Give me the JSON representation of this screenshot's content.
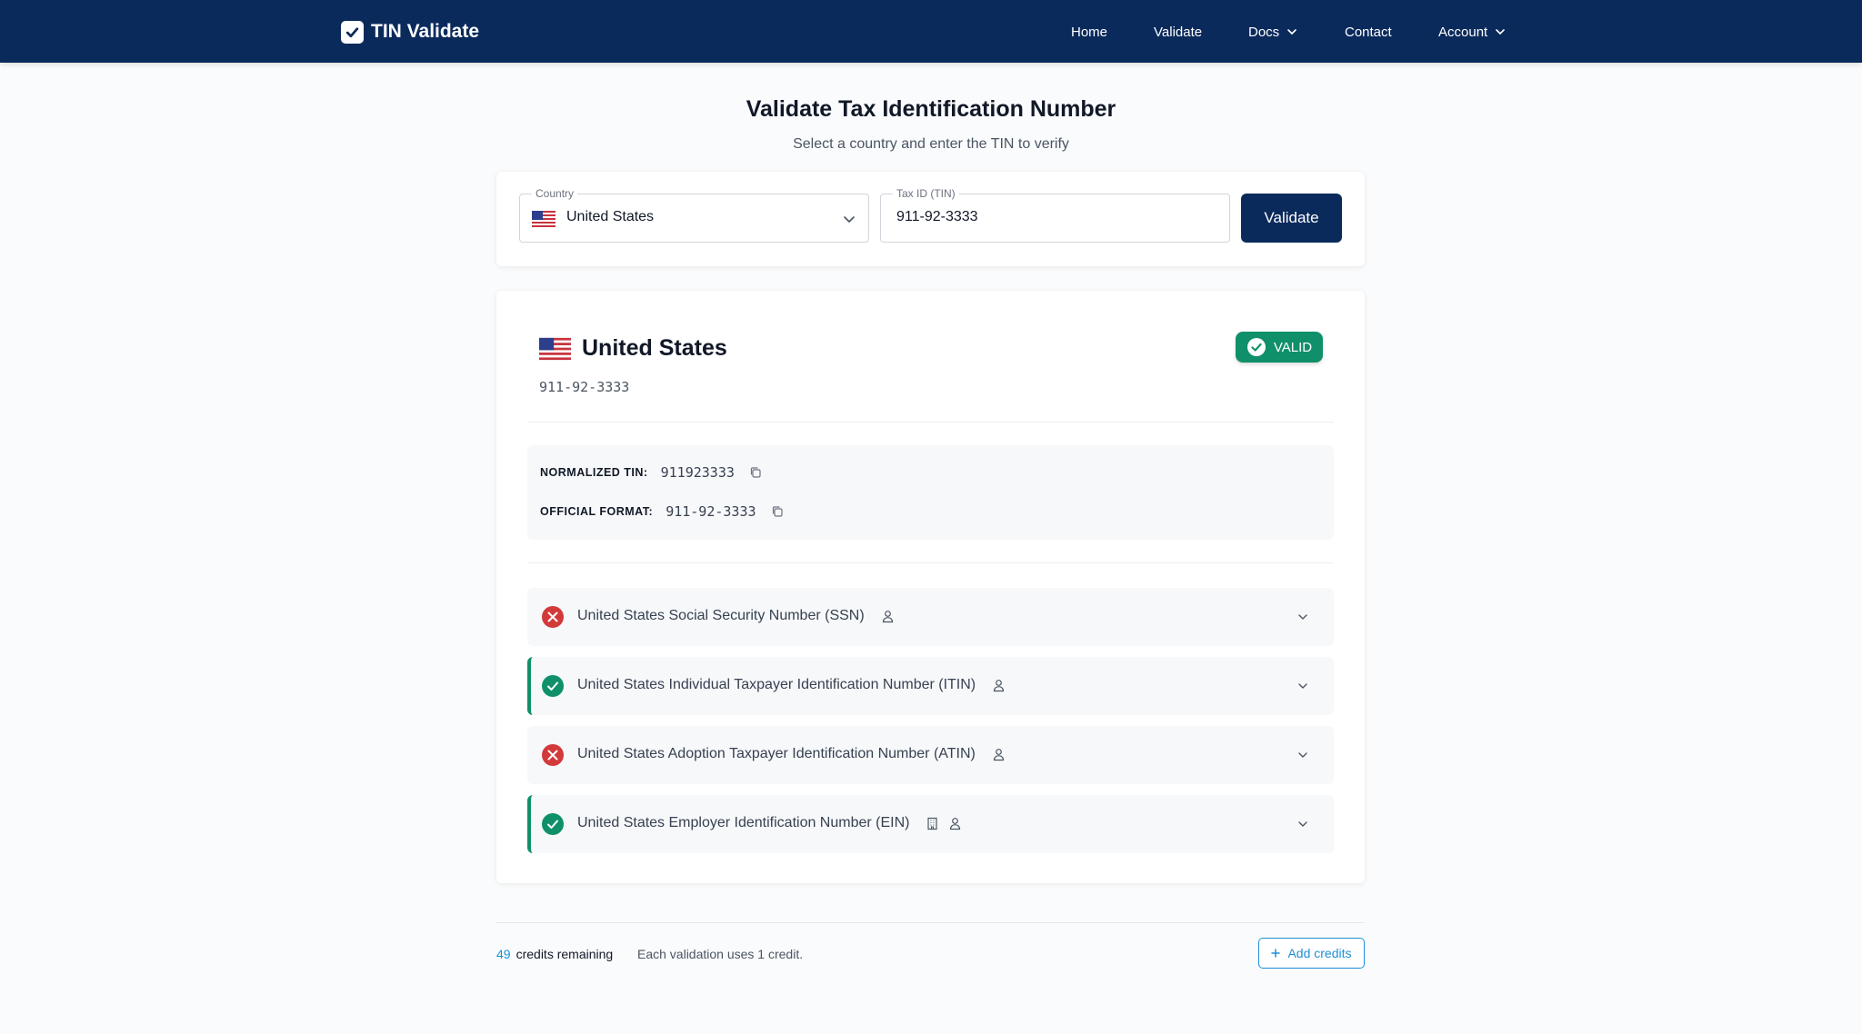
{
  "app": {
    "name": "TIN Validate"
  },
  "nav": {
    "home": "Home",
    "validate": "Validate",
    "docs": "Docs",
    "contact": "Contact",
    "account": "Account"
  },
  "page": {
    "title": "Validate Tax Identification Number",
    "subtitle": "Select a country and enter the TIN to verify"
  },
  "form": {
    "country_label": "Country",
    "country_value": "United States",
    "tin_label": "Tax ID (TIN)",
    "tin_value": "911-92-3333",
    "submit_label": "Validate"
  },
  "result": {
    "country": "United States",
    "tin": "911-92-3333",
    "status": "VALID",
    "normalized_label": "NORMALIZED TIN:",
    "normalized_value": "911923333",
    "official_label": "OFFICIAL FORMAT:",
    "official_value": "911-92-3333",
    "types": [
      {
        "name": "United States Social Security Number (SSN)",
        "valid": false,
        "icons": [
          "person-icon"
        ]
      },
      {
        "name": "United States Individual Taxpayer Identification Number (ITIN)",
        "valid": true,
        "icons": [
          "person-icon"
        ]
      },
      {
        "name": "United States Adoption Taxpayer Identification Number (ATIN)",
        "valid": false,
        "icons": [
          "person-icon"
        ]
      },
      {
        "name": "United States Employer Identification Number (EIN)",
        "valid": true,
        "icons": [
          "building-icon",
          "person-icon"
        ]
      }
    ]
  },
  "footer": {
    "credits_count": "49",
    "credits_label": "credits remaining",
    "credits_note": "Each validation uses 1 credit.",
    "add_credits_label": "Add credits"
  },
  "colors": {
    "navbar": "#0b2a5c",
    "valid_green": "#10906a",
    "invalid_red": "#d23a3a",
    "accent_blue": "#1d8fd6"
  }
}
